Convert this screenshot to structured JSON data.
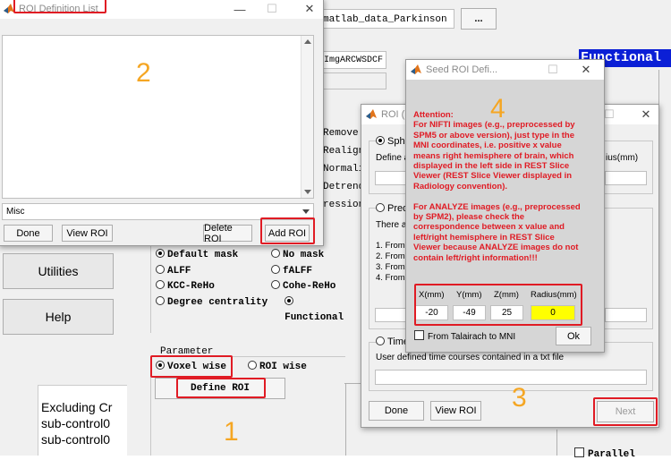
{
  "background": {
    "data_path": "matlab_data_Parkinson",
    "browse_label": "...",
    "prefix": "FunImgARCWSDCF_fragment",
    "prefix_text": "FunImgARCWSDCF",
    "functional_label": "Functional",
    "checklist": [
      "Remove",
      "Realign",
      "Normali",
      "Detrend",
      "ression"
    ],
    "sidebar_buttons": [
      "Utilities",
      "Help"
    ],
    "mask_options": [
      {
        "label": "Default mask",
        "selected": true
      },
      {
        "label": "No mask",
        "selected": false
      },
      {
        "label": "ALFF",
        "selected": false
      },
      {
        "label": "fALFF",
        "selected": false
      },
      {
        "label": "KCC-ReHo",
        "selected": false
      },
      {
        "label": "Cohe-ReHo",
        "selected": false
      },
      {
        "label": "Degree centrality",
        "selected": false
      },
      {
        "label": "Functional",
        "selected": true
      }
    ],
    "parameter_label": "Parameter",
    "voxel_wise": "Voxel wise",
    "roi_wise": "ROI wise",
    "define_roi": "Define ROI",
    "subject_list": [
      "Excluding Cr",
      "sub-control0",
      "sub-control0"
    ],
    "parallel_label": "Parallel"
  },
  "roi_list_window": {
    "title": "ROI Definition List",
    "dropdown_value": "Misc",
    "buttons": {
      "done": "Done",
      "view": "View ROI",
      "delete": "Delete ROI",
      "add": "Add ROI"
    }
  },
  "roi_dialog": {
    "title": "ROI (R",
    "sphere_label": "Sphe",
    "define_label": "Define a",
    "radius_label": "ius(mm)",
    "predefined_label": "Prede",
    "there_are": "There ar",
    "list_lines": [
      "1. From s",
      "2. From A",
      "3. From N",
      "4. From t"
    ],
    "time_label": "Time",
    "time_desc": "User defined time courses contained in a txt file",
    "buttons": {
      "done": "Done",
      "view": "View ROI",
      "next": "Next"
    }
  },
  "seed_dialog": {
    "title": "Seed ROI Defi...",
    "attention": [
      "Attention:",
      "For NIFTI images (e.g., preprocessed by",
      "SPM5 or above version), just type in the",
      "MNI coordinates, i.e. positive x value",
      "means right hemisphere of brain, which",
      "displayed in the left side in REST Slice",
      "Viewer (REST Slice Viewer displayed in",
      "Radiology convention).",
      "",
      "For ANALYZE images (e.g., preprocessed",
      "by SPM2), please check the",
      "correspondence between x value and",
      "left/right hemisphere in REST Slice",
      "Viewer because ANALYZE images do not",
      "contain left/right information!!!"
    ],
    "fields": [
      {
        "label": "X(mm)",
        "value": "-20"
      },
      {
        "label": "Y(mm)",
        "value": "-49"
      },
      {
        "label": "Z(mm)",
        "value": "25"
      },
      {
        "label": "Radius(mm)",
        "value": "0"
      }
    ],
    "talairach_label": "From Talairach to MNI",
    "ok_label": "Ok"
  },
  "annotations": {
    "step1": "1",
    "step2": "2",
    "step3": "3",
    "step4": "4"
  },
  "colors": {
    "highlight": "#e01b24",
    "step_number": "#f5a623",
    "radius_field": "#ffff00",
    "functional_bg": "#0b1fd6"
  }
}
